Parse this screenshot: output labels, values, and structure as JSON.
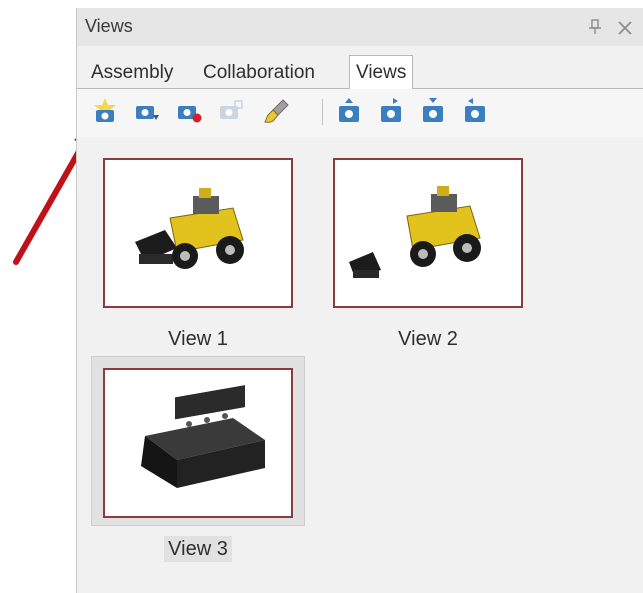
{
  "panel": {
    "title": "Views",
    "pin_icon": "pin-icon",
    "close_icon": "close-icon"
  },
  "tabs": [
    {
      "label": "Assembly",
      "active": false
    },
    {
      "label": "Collaboration",
      "active": false
    },
    {
      "label": "Views",
      "active": true
    }
  ],
  "toolbar": {
    "buttons": [
      {
        "name": "new-view-icon"
      },
      {
        "name": "camera-update-icon"
      },
      {
        "name": "camera-delete-icon"
      },
      {
        "name": "camera-disabled-icon"
      },
      {
        "name": "brush-icon"
      },
      {
        "name": "camera-up-icon"
      },
      {
        "name": "camera-right-icon"
      },
      {
        "name": "camera-down-icon"
      },
      {
        "name": "camera-left-icon"
      }
    ]
  },
  "views": [
    {
      "label": "View 1",
      "selected": false,
      "image": "loader-vehicle-with-bucket"
    },
    {
      "label": "View 2",
      "selected": false,
      "image": "loader-vehicle-detached-bucket"
    },
    {
      "label": "View 3",
      "selected": true,
      "image": "black-bucket-part"
    }
  ],
  "colors": {
    "thumb_border": "#8a3b3b",
    "annotation_arrow": "#c0101a",
    "vehicle_yellow": "#e2c21c"
  }
}
